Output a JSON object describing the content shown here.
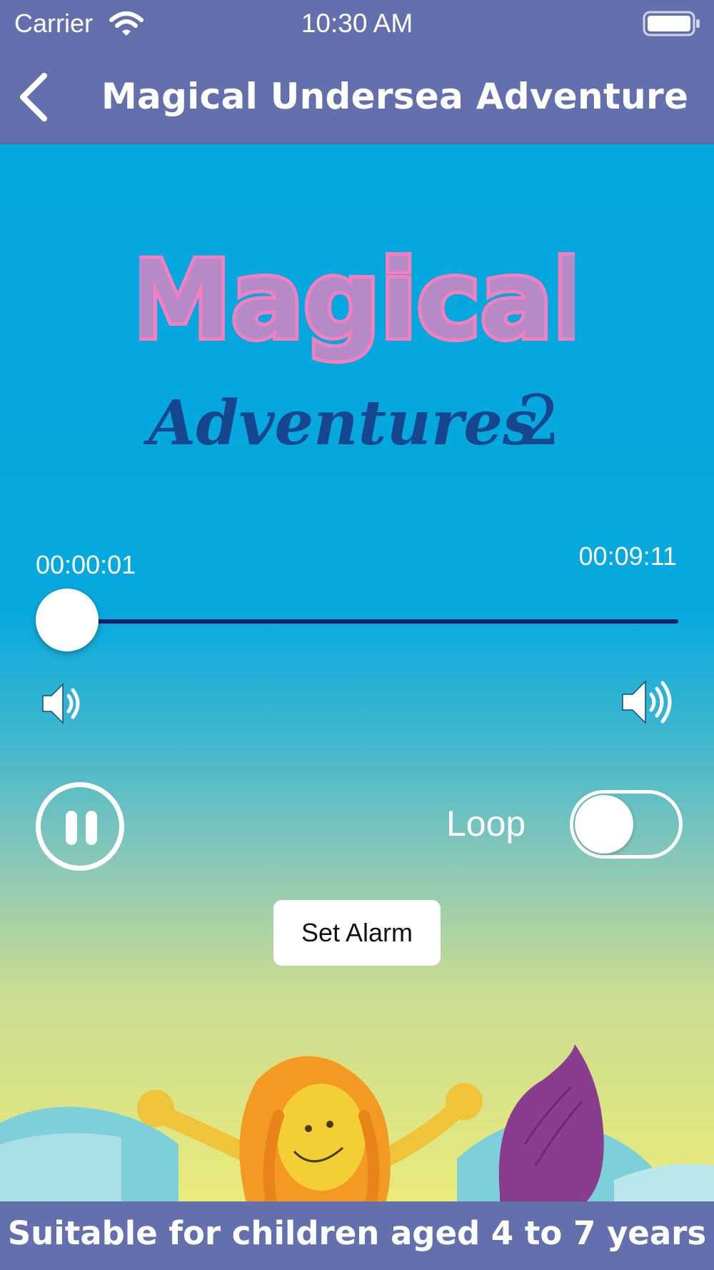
{
  "status_bar": {
    "carrier": "Carrier",
    "time": "10:30 AM"
  },
  "nav": {
    "title": "Magical Undersea Adventure"
  },
  "logo": {
    "line1": "Magical",
    "line2": "Adventures",
    "number": "2"
  },
  "player": {
    "current_time": "00:00:01",
    "total_time": "00:09:11",
    "progress": 0.0018,
    "loop_label": "Loop",
    "loop_enabled": false,
    "state": "playing"
  },
  "alarm_button": {
    "label": "Set Alarm"
  },
  "footer": {
    "text": "Suitable for children aged 4 to 7 years"
  },
  "colors": {
    "bar": "#6470ad",
    "sky_top": "#03a8de",
    "track": "#0d1f66",
    "logo_pink": "#f27fbf",
    "logo_blue": "#16478e",
    "tail": "#8a3c8f"
  }
}
